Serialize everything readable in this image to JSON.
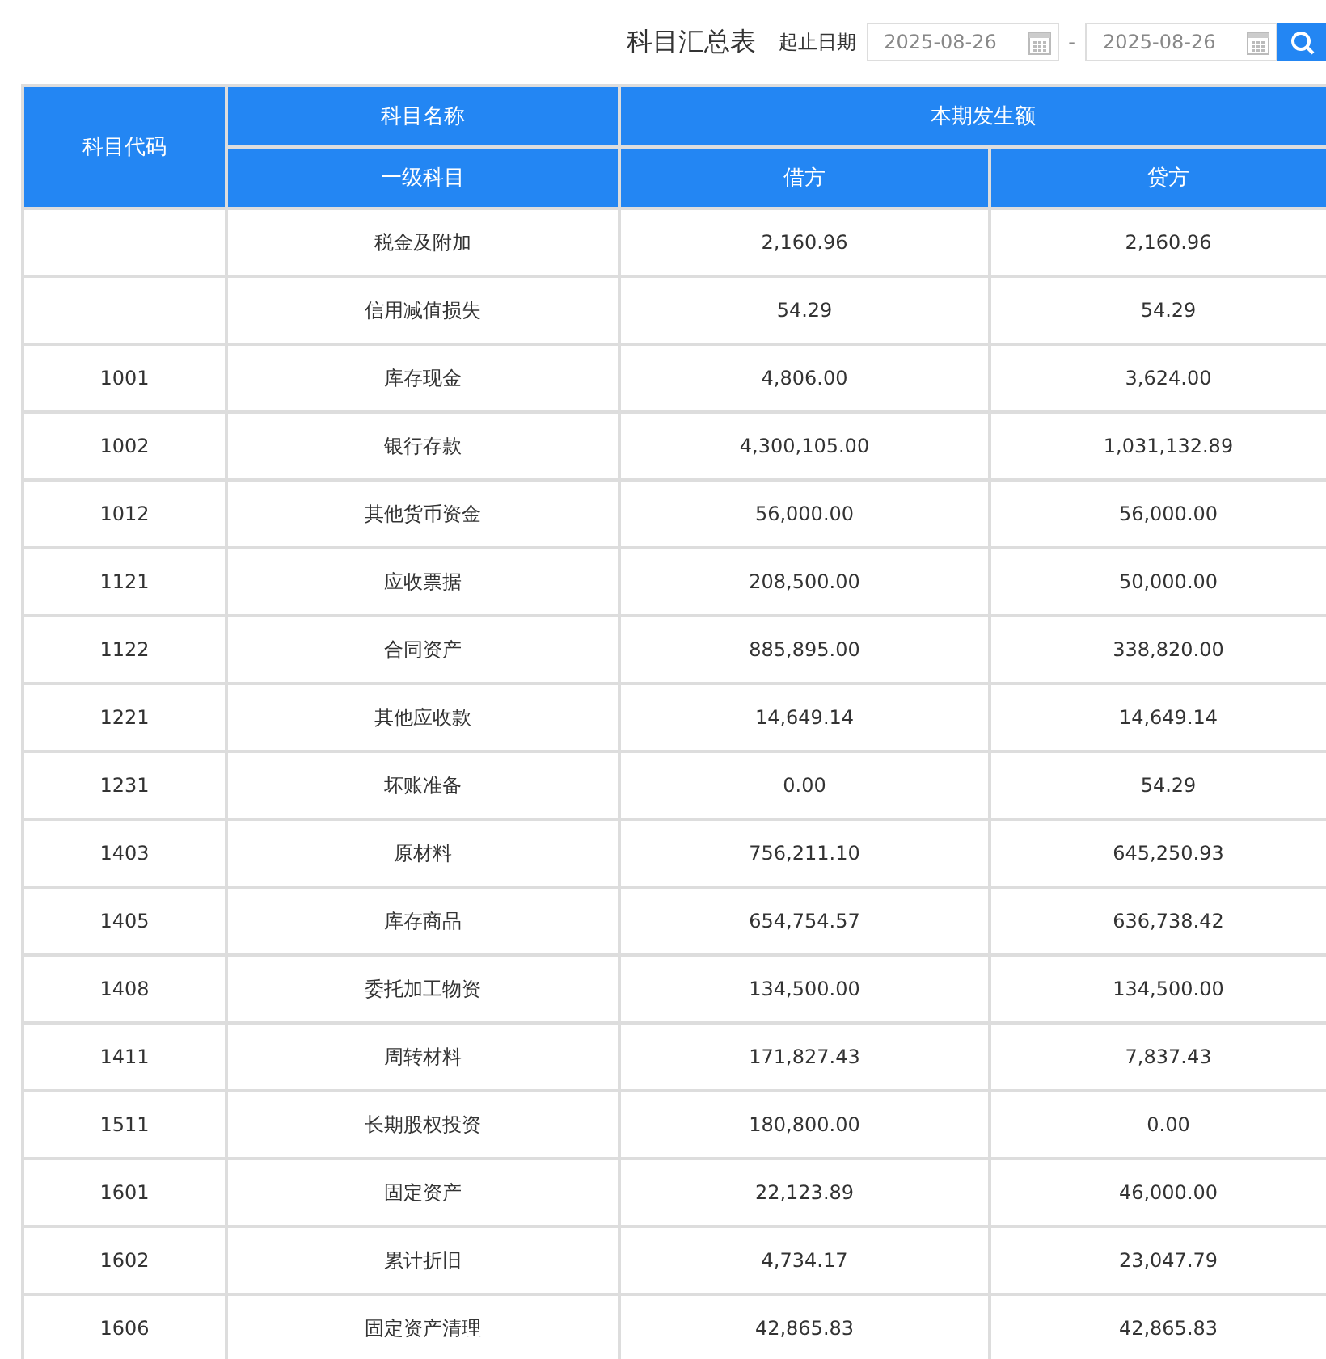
{
  "title": "科目汇总表",
  "date_label": "起止日期",
  "start_date": "2025-08-26",
  "separator": "-",
  "end_date": "2025-08-26",
  "table": {
    "header_top": {
      "code": "科目代码",
      "name": "科目名称",
      "amount": "本期发生额"
    },
    "header_sub": {
      "name": "一级科目",
      "debit": "借方",
      "credit": "贷方"
    },
    "rows": [
      {
        "name": "税金及附加",
        "debit": "2,160.96",
        "credit": "2,160.96"
      },
      {
        "name": "信用减值损失",
        "debit": "54.29",
        "credit": "54.29"
      },
      {
        "code": "1001",
        "name": "库存现金",
        "debit": "4,806.00",
        "credit": "3,624.00"
      },
      {
        "code": "1002",
        "name": "银行存款",
        "debit": "4,300,105.00",
        "credit": "1,031,132.89"
      },
      {
        "code": "1012",
        "name": "其他货币资金",
        "debit": "56,000.00",
        "credit": "56,000.00"
      },
      {
        "code": "1121",
        "name": "应收票据",
        "debit": "208,500.00",
        "credit": "50,000.00"
      },
      {
        "code": "1122",
        "name": "合同资产",
        "debit": "885,895.00",
        "credit": "338,820.00"
      },
      {
        "code": "1221",
        "name": "其他应收款",
        "debit": "14,649.14",
        "credit": "14,649.14"
      },
      {
        "code": "1231",
        "name": "坏账准备",
        "debit": "0.00",
        "credit": "54.29"
      },
      {
        "code": "1403",
        "name": "原材料",
        "debit": "756,211.10",
        "credit": "645,250.93"
      },
      {
        "code": "1405",
        "name": "库存商品",
        "debit": "654,754.57",
        "credit": "636,738.42"
      },
      {
        "code": "1408",
        "name": "委托加工物资",
        "debit": "134,500.00",
        "credit": "134,500.00"
      },
      {
        "code": "1411",
        "name": "周转材料",
        "debit": "171,827.43",
        "credit": "7,837.43"
      },
      {
        "code": "1511",
        "name": "长期股权投资",
        "debit": "180,800.00",
        "credit": "0.00"
      },
      {
        "code": "1601",
        "name": "固定资产",
        "debit": "22,123.89",
        "credit": "46,000.00"
      },
      {
        "code": "1602",
        "name": "累计折旧",
        "debit": "4,734.17",
        "credit": "23,047.79"
      },
      {
        "code": "1606",
        "name": "固定资产清理",
        "debit": "42,865.83",
        "credit": "42,865.83"
      }
    ]
  }
}
